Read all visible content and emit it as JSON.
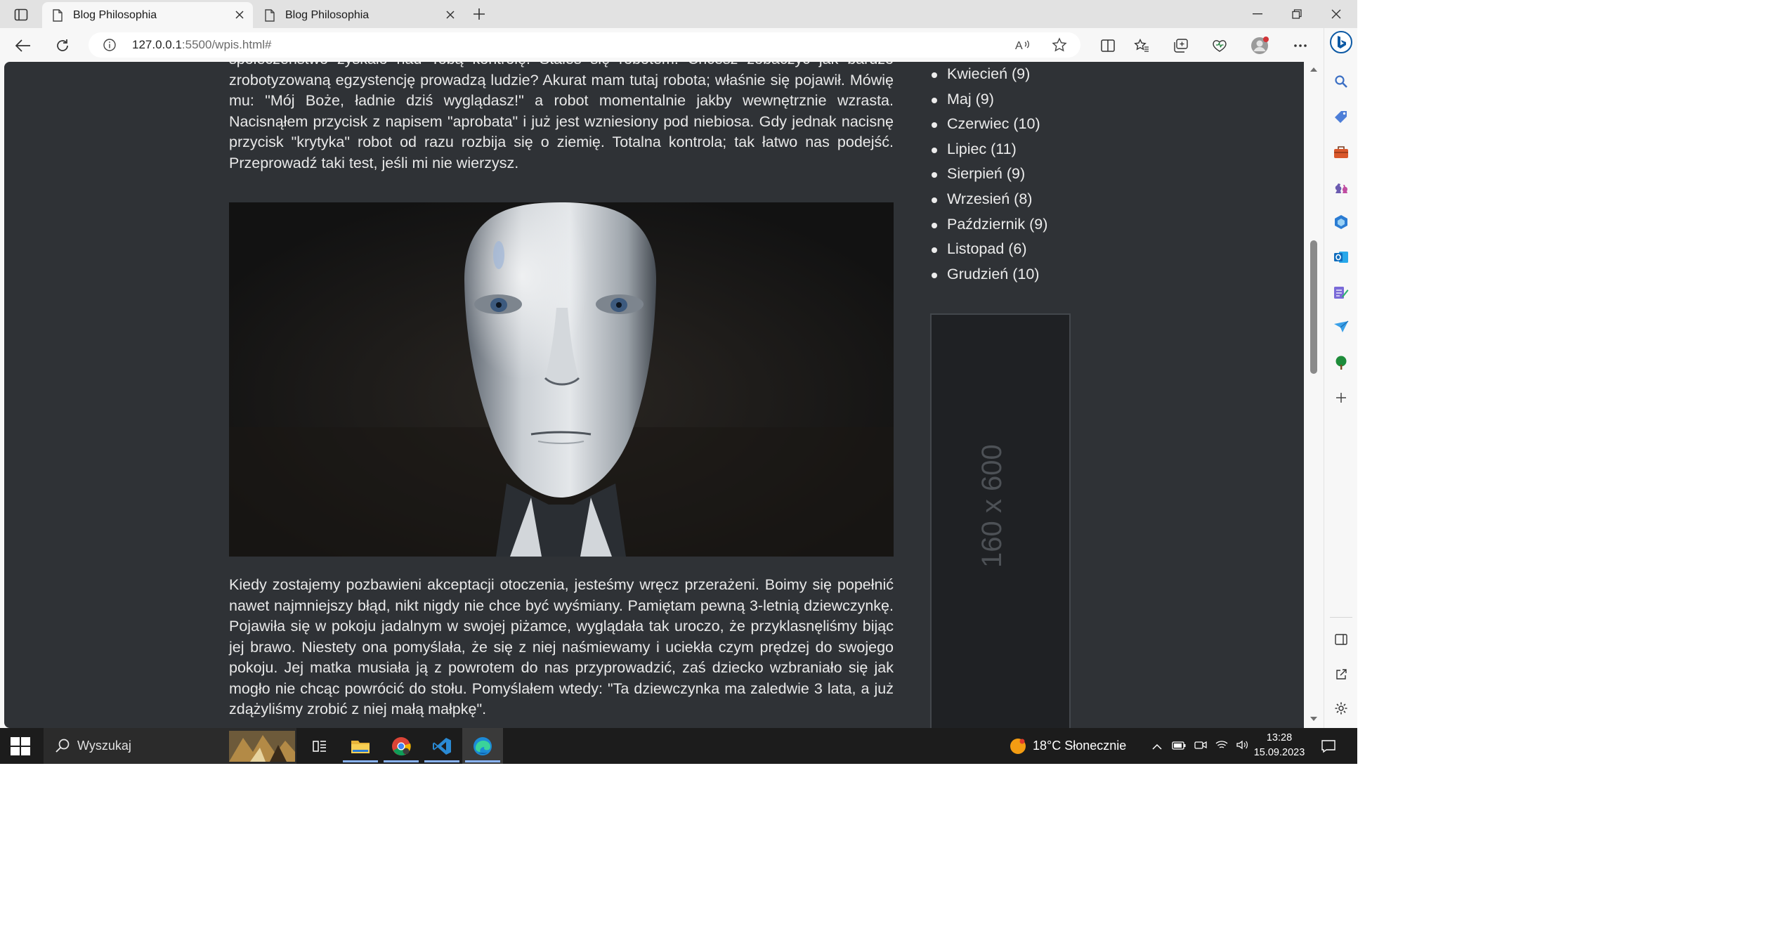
{
  "browser": {
    "tabs": [
      {
        "title": "Blog Philosophia",
        "active": true
      },
      {
        "title": "Blog Philosophia",
        "active": false
      }
    ],
    "url_host": "127.0.0.1",
    "url_path": ":5500/wpis.html#"
  },
  "article": {
    "paragraph_1": "społeczeństwo zyskało nad Tobą kontrolę. Stałeś się robotem. Chcesz zobaczyć jak bardzo zrobotyzowaną egzystencję prowadzą ludzie? Akurat mam tutaj robota; właśnie się pojawił. Mówię mu: \"Mój Boże, ładnie dziś wyglądasz!\" a robot momentalnie jakby wewnętrznie wzrasta. Nacisnąłem przycisk z napisem \"aprobata\" i już jest wzniesiony pod niebiosa. Gdy jednak nacisnę przycisk \"krytyka\" robot od razu rozbija się o ziemię. Totalna kontrola; tak łatwo nas podejść. Przeprowadź taki test, jeśli mi nie wierzysz.",
    "paragraph_2": "Kiedy zostajemy pozbawieni akceptacji otoczenia, jesteśmy wręcz przerażeni. Boimy się popełnić nawet najmniejszy błąd, nikt nigdy nie chce być wyśmiany. Pamiętam pewną 3-letnią dziewczynkę. Pojawiła się w pokoju jadalnym w swojej piżamce, wyglądała tak uroczo, że przyklasnęliśmy bijąc jej brawo. Niestety ona pomyślała, że się z niej naśmiewamy i uciekła czym prędzej do swojego pokoju. Jej matka musiała ją z powrotem do nas przyprowadzić, zaś dziecko wzbraniało się jak mogło nie chcąc powrócić do stołu. Pomyślałem wtedy: \"Ta dziewczynka ma zaledwie 3 lata, a już zdążyliśmy zrobić z niej małą małpkę\"."
  },
  "archive": [
    "Kwiecień (9)",
    "Maj (9)",
    "Czerwiec (10)",
    "Lipiec (11)",
    "Sierpień (9)",
    "Wrzesień (8)",
    "Październik (9)",
    "Listopad (6)",
    "Grudzień (10)"
  ],
  "ad_placeholder": "160 x 600",
  "taskbar": {
    "search_label": "Wyszukaj",
    "weather": "18°C  Słonecznie",
    "time": "13:28",
    "date": "15.09.2023"
  },
  "colors": {
    "page_background": "#2f3236",
    "taskbar": "#1c1c1c",
    "edge_accent": "#0c59a4"
  }
}
